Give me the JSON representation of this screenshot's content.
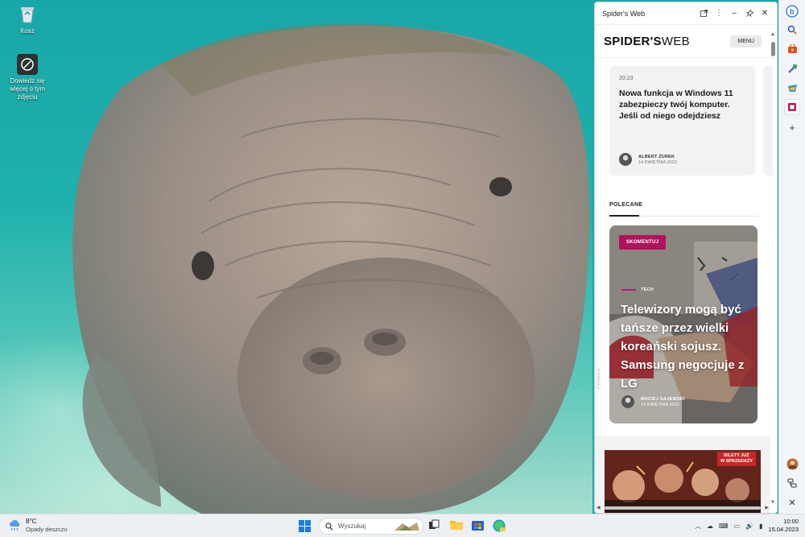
{
  "desktop": {
    "icons": [
      {
        "label": "Kosz",
        "icon": "recycle-bin-icon"
      },
      {
        "label": "Dowiedz się więcej o tym zdjęciu",
        "icon": "learn-about-picture-icon"
      }
    ]
  },
  "panel": {
    "title": "Spider's Web",
    "buttons": [
      "open-in-new-tab-icon",
      "more-icon",
      "minimize-icon",
      "pin-icon",
      "close-icon"
    ]
  },
  "site": {
    "logo_bold": "SPIDER'S",
    "logo_thin": "WEB",
    "menu_label": "MENU",
    "news_card": {
      "time": "20:23",
      "headline": "Nowa funkcja w Windows 11 zabezpieczy twój komputer. Jeśli od niego odejdziesz",
      "author": "ALBERT ŻUREK",
      "date": "14 KWIETNIA 2023"
    },
    "section_title": "POLECANE",
    "feature": {
      "badge": "SKOMENTUJ",
      "category": "TECH",
      "headline": "Telewizory mogą być tańsze przez wielki koreański sojusz. Samsung negocjuje z LG",
      "author": "MACIEJ GAJEWSKI",
      "date": "14 KWIETNIA 2023"
    },
    "watermark": "Pyrowizor",
    "ad_badge_line1": "BILETY JUŻ",
    "ad_badge_line2": "W SPRZEDAŻY"
  },
  "rail": {
    "icons": [
      "bing-chat-icon",
      "search-icon",
      "shopping-icon",
      "tools-icon",
      "games-icon",
      "office-icon",
      "spiders-web-app-icon",
      "add-icon",
      "profile-avatar-icon",
      "split-screen-icon",
      "close-sidebar-icon"
    ]
  },
  "taskbar": {
    "weather_temp": "8°C",
    "weather_desc": "Opady deszczu",
    "search_placeholder": "Wyszukaj",
    "time": "10:00",
    "date": "15.04.2023"
  },
  "colors": {
    "accent_magenta": "#b0135d",
    "water": "#1aa7a6",
    "sand": "#a7ddcf"
  }
}
